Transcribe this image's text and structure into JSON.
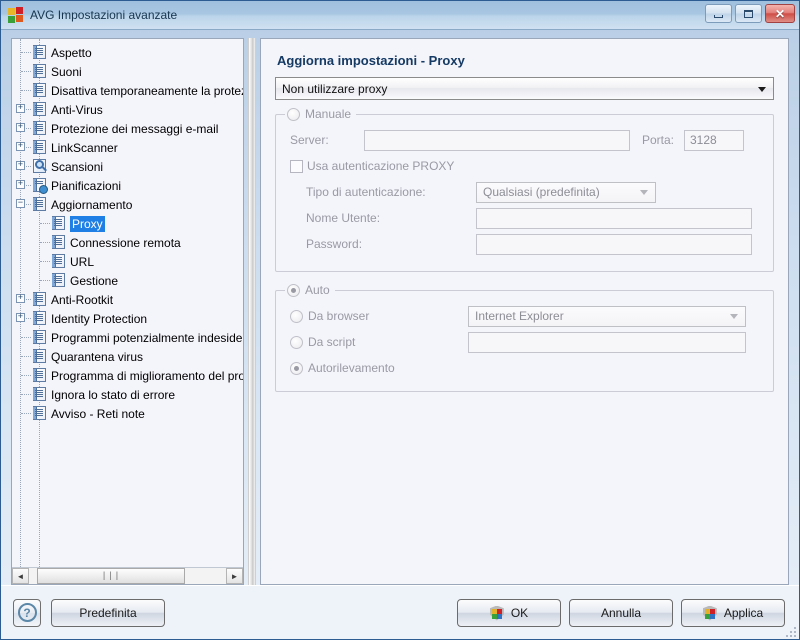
{
  "window": {
    "title": "AVG Impostazioni avanzate",
    "icon": "avg-logo-icon",
    "minimize_label": "",
    "maximize_label": "",
    "close_label": "✕"
  },
  "tree": {
    "items": [
      {
        "label": "Aspetto",
        "level": 1,
        "expander": "",
        "icon": "document-icon",
        "selected": false
      },
      {
        "label": "Suoni",
        "level": 1,
        "expander": "",
        "icon": "document-icon",
        "selected": false
      },
      {
        "label": "Disattiva temporaneamente la protezione AVG",
        "level": 1,
        "expander": "",
        "icon": "document-icon",
        "selected": false
      },
      {
        "label": "Anti-Virus",
        "level": 1,
        "expander": "+",
        "icon": "document-icon",
        "selected": false
      },
      {
        "label": "Protezione dei messaggi e-mail",
        "level": 1,
        "expander": "+",
        "icon": "document-icon",
        "selected": false
      },
      {
        "label": "LinkScanner",
        "level": 1,
        "expander": "+",
        "icon": "document-icon",
        "selected": false
      },
      {
        "label": "Scansioni",
        "level": 1,
        "expander": "+",
        "icon": "magnifier-icon",
        "selected": false
      },
      {
        "label": "Pianificazioni",
        "level": 1,
        "expander": "+",
        "icon": "clock-icon",
        "selected": false
      },
      {
        "label": "Aggiornamento",
        "level": 1,
        "expander": "−",
        "icon": "document-icon",
        "selected": false
      },
      {
        "label": "Proxy",
        "level": 2,
        "expander": "",
        "icon": "document-icon",
        "selected": true
      },
      {
        "label": "Connessione remota",
        "level": 2,
        "expander": "",
        "icon": "document-icon",
        "selected": false
      },
      {
        "label": "URL",
        "level": 2,
        "expander": "",
        "icon": "document-icon",
        "selected": false
      },
      {
        "label": "Gestione",
        "level": 2,
        "expander": "",
        "icon": "document-icon",
        "selected": false
      },
      {
        "label": "Anti-Rootkit",
        "level": 1,
        "expander": "+",
        "icon": "document-icon",
        "selected": false
      },
      {
        "label": "Identity Protection",
        "level": 1,
        "expander": "+",
        "icon": "document-icon",
        "selected": false
      },
      {
        "label": "Programmi potenzialmente indesiderati",
        "level": 1,
        "expander": "",
        "icon": "document-icon",
        "selected": false
      },
      {
        "label": "Quarantena virus",
        "level": 1,
        "expander": "",
        "icon": "document-icon",
        "selected": false
      },
      {
        "label": "Programma di miglioramento del prodotto",
        "level": 1,
        "expander": "",
        "icon": "document-icon",
        "selected": false
      },
      {
        "label": "Ignora lo stato di errore",
        "level": 1,
        "expander": "",
        "icon": "document-icon",
        "selected": false
      },
      {
        "label": "Avviso - Reti note",
        "level": 1,
        "expander": "",
        "icon": "document-icon",
        "selected": false
      }
    ],
    "hscroll": {
      "left_arrow": "◄",
      "right_arrow": "►",
      "grip": "|||"
    }
  },
  "panel": {
    "title": "Aggiorna impostazioni - Proxy",
    "mode_combo": {
      "value": "Non utilizzare proxy",
      "enabled": true
    },
    "manual": {
      "legend": "Manuale",
      "selected": false,
      "enabled": false,
      "server_label": "Server:",
      "server_value": "",
      "port_label": "Porta:",
      "port_value": "3128",
      "use_auth_label": "Usa autenticazione PROXY",
      "use_auth_checked": false,
      "auth_type_label": "Tipo di autenticazione:",
      "auth_type_value": "Qualsiasi (predefinita)",
      "username_label": "Nome Utente:",
      "username_value": "",
      "password_label": "Password:",
      "password_value": ""
    },
    "auto": {
      "legend": "Auto",
      "selected": true,
      "enabled": false,
      "from_browser_label": "Da browser",
      "from_browser_selected": false,
      "browser_value": "Internet Explorer",
      "from_script_label": "Da script",
      "from_script_selected": false,
      "script_value": "",
      "autodetect_label": "Autorilevamento",
      "autodetect_selected": true
    }
  },
  "footer": {
    "help_label": "?",
    "default_button": "Predefinita",
    "ok_button": "OK",
    "cancel_button": "Annulla",
    "apply_button": "Applica"
  }
}
